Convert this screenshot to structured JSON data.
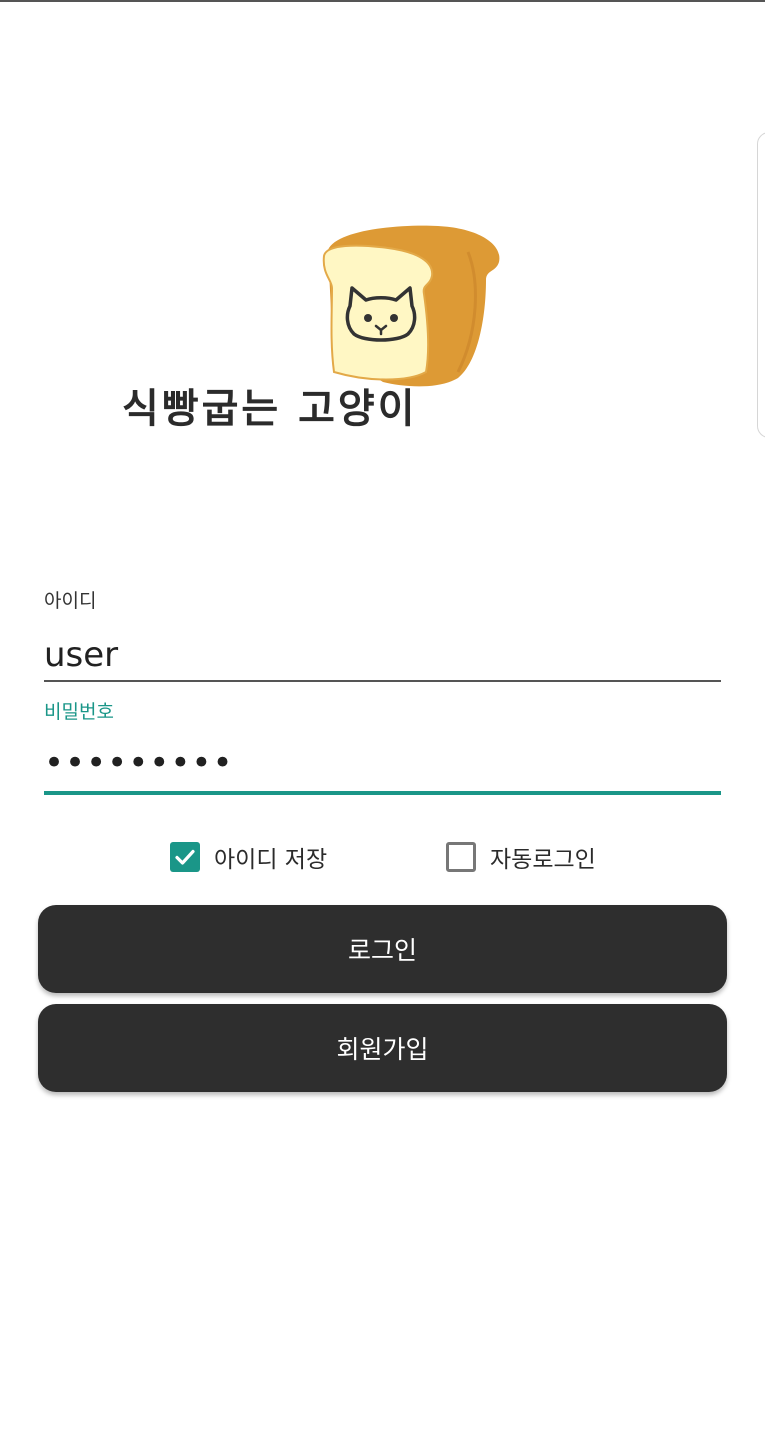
{
  "app": {
    "logo_text": "식빵굽는 고양이",
    "logo_image": "bread-cat-icon"
  },
  "form": {
    "id_label": "아이디",
    "id_value": "user",
    "password_label": "비밀번호",
    "password_value": "•••••••••"
  },
  "options": {
    "save_id_label": "아이디 저장",
    "save_id_checked": true,
    "auto_login_label": "자동로그인",
    "auto_login_checked": false
  },
  "buttons": {
    "login_label": "로그인",
    "signup_label": "회원가입"
  },
  "colors": {
    "accent": "#1a9688",
    "button_bg": "#2e2e2e",
    "bread_crust": "#dd9a35",
    "bread_inner": "#fff7c4"
  }
}
